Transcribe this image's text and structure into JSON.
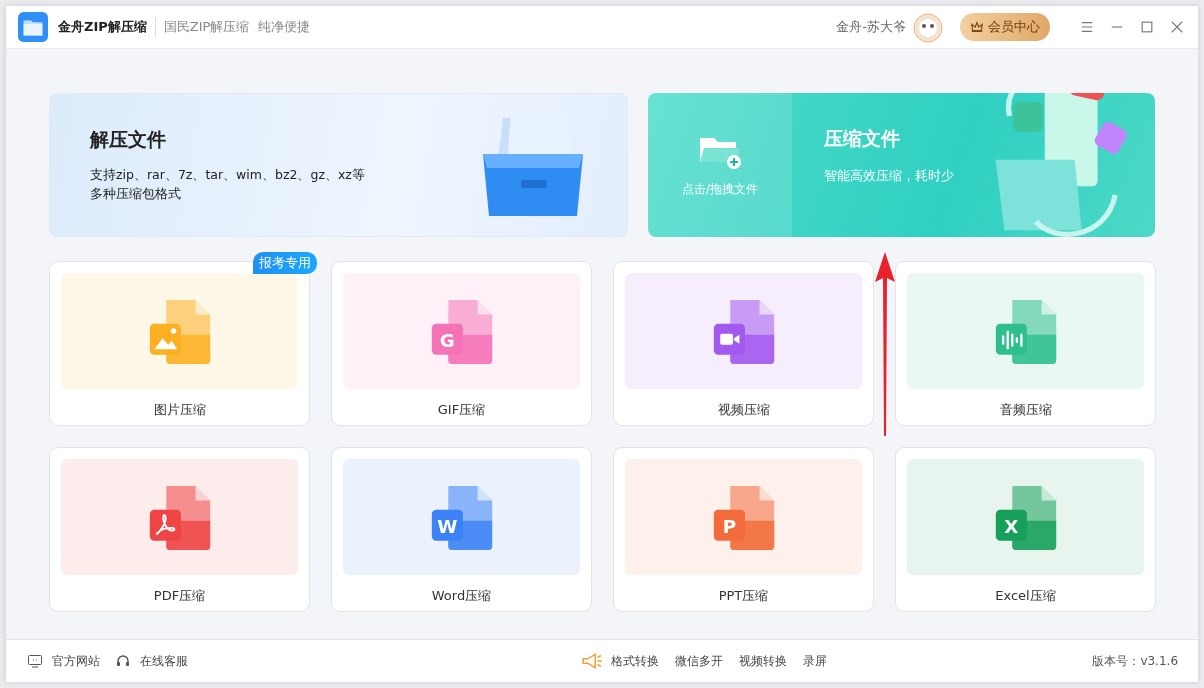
{
  "title_bar": {
    "app_name": "金舟ZIP解压缩",
    "slogan": "国民ZIP解压缩  纯净便捷",
    "user_name": "金舟-苏大爷",
    "vip_button": "会员中心"
  },
  "extract_card": {
    "title": "解压文件",
    "description_lines": [
      "支持zip、rar、7z、tar、wim、bz2、gz、xz等",
      "多种压缩包格式"
    ]
  },
  "compress_card": {
    "drop_label": "点击/拖拽文件",
    "title": "压缩文件",
    "description": "智能高效压缩，耗时少"
  },
  "tools": [
    {
      "kind": "image",
      "label": "图片压缩",
      "color": "#fdb022",
      "badge": "报考专用"
    },
    {
      "kind": "gif",
      "label": "GIF压缩",
      "color": "#f472b6",
      "glyph": "G"
    },
    {
      "kind": "video",
      "label": "视频压缩",
      "color": "#a259f0"
    },
    {
      "kind": "audio",
      "label": "音频压缩",
      "color": "#2fbf8f"
    },
    {
      "kind": "pdf",
      "label": "PDF压缩",
      "color": "#ef4444"
    },
    {
      "kind": "word",
      "label": "Word压缩",
      "color": "#3b82f6",
      "glyph": "W"
    },
    {
      "kind": "ppt",
      "label": "PPT压缩",
      "color": "#f26b3a",
      "glyph": "P"
    },
    {
      "kind": "excel",
      "label": "Excel压缩",
      "color": "#16a05a",
      "glyph": "X"
    }
  ],
  "footer": {
    "left": [
      {
        "kind": "website",
        "label": "官方网站"
      },
      {
        "kind": "support",
        "label": "在线客服"
      }
    ],
    "promo": [
      "格式转换",
      "微信多开",
      "视频转换",
      "录屏"
    ],
    "version": "版本号：v3.1.6"
  }
}
